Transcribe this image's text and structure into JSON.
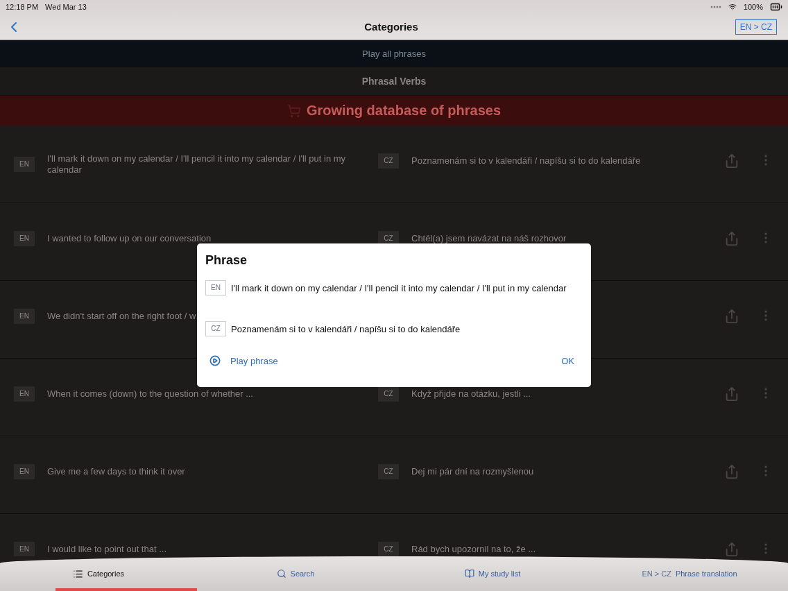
{
  "status_bar": {
    "time": "12:18 PM",
    "date": "Wed Mar 13",
    "battery": "100%"
  },
  "nav": {
    "title": "Categories",
    "language_button": "EN > CZ"
  },
  "play_all": "Play all phrases",
  "category": "Phrasal Verbs",
  "banner": "Growing database of phrases",
  "rows": [
    {
      "en_badge": "EN",
      "en": "I'll mark it down on my calendar / I'll pencil it into my calendar / I'll put in my calendar",
      "cz_badge": "CZ",
      "cz": "Poznamenám si to v kalendáři / napíšu si to do kalendáře"
    },
    {
      "en_badge": "EN",
      "en": "I wanted to follow up on our conversation",
      "cz_badge": "CZ",
      "cz": "Chtěl(a) jsem navázat na náš rozhovor"
    },
    {
      "en_badge": "EN",
      "en": "We didn't start off on the right foot / w"
    },
    {
      "en_badge": "EN",
      "en": "When it comes (down) to the question of whether ...",
      "cz_badge": "CZ",
      "cz": "Když přijde na otázku, jestli ..."
    },
    {
      "en_badge": "EN",
      "en": "Give me a few days to think it over",
      "cz_badge": "CZ",
      "cz": "Dej mi pár dní na rozmyšlenou"
    },
    {
      "en_badge": "EN",
      "en": "I would like to point out that ...",
      "cz_badge": "CZ",
      "cz": "Rád bych upozornil na to, že ..."
    }
  ],
  "dialog": {
    "title": "Phrase",
    "lines": [
      {
        "badge": "EN",
        "text": "I'll mark it down on my calendar / I'll pencil it into my calendar / I'll put in my calendar"
      },
      {
        "badge": "CZ",
        "text": "Poznamenám si to v kalendáři / napíšu si to do kalendáře"
      }
    ],
    "play": "Play phrase",
    "ok": "OK"
  },
  "tabs": [
    {
      "kind": "list",
      "label": "Categories",
      "selected": true
    },
    {
      "kind": "search",
      "label": "Search",
      "selected": false
    },
    {
      "kind": "book",
      "label": "My study list",
      "selected": false
    },
    {
      "kind": "lang",
      "prefix": "EN > CZ",
      "label": "Phrase translation",
      "selected": false
    }
  ]
}
